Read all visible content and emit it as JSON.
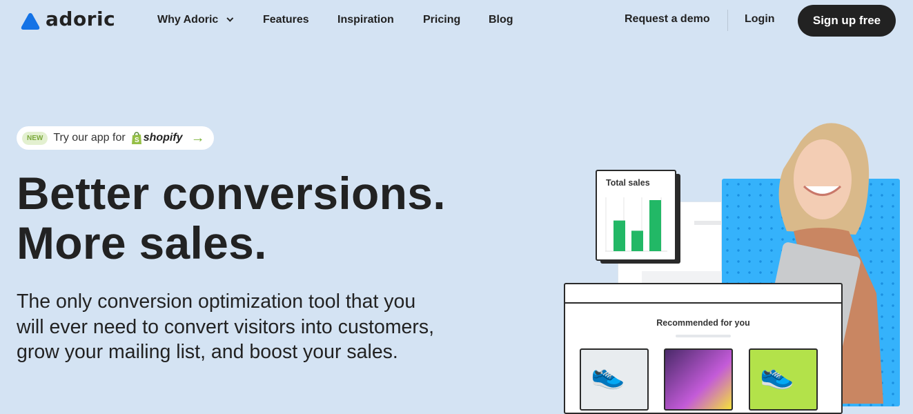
{
  "brand": {
    "name": "adoric",
    "logo_color": "#1473e6"
  },
  "nav": {
    "items": [
      {
        "label": "Why Adoric",
        "has_dropdown": true
      },
      {
        "label": "Features"
      },
      {
        "label": "Inspiration"
      },
      {
        "label": "Pricing"
      },
      {
        "label": "Blog"
      }
    ],
    "request_demo": "Request a demo",
    "login": "Login",
    "signup": "Sign up free"
  },
  "badge": {
    "tag": "NEW",
    "text": "Try our app for",
    "brand": "shopify"
  },
  "hero": {
    "line1": "Better conversions.",
    "line2": "More sales.",
    "subtitle": "The only conversion optimization tool that you will ever need to convert visitors into customers, grow your mailing list, and boost your sales."
  },
  "illustration": {
    "sales_card_title": "Total sales",
    "sales_bars": [
      0.6,
      0.4,
      1.0
    ],
    "bar_color": "#22b866",
    "recommend_title": "Recommended for you"
  }
}
